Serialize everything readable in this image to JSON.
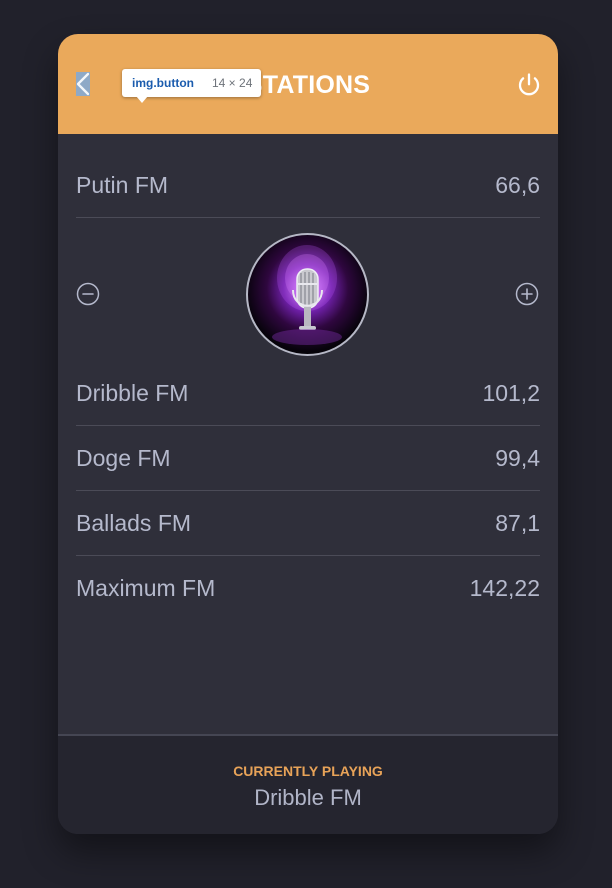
{
  "devtools_tooltip": {
    "element_name": "img.button",
    "element_type": "img",
    "element_class": ".button",
    "dimensions": "14 × 24"
  },
  "header": {
    "title": "STATIONS",
    "back_icon": "chevron-left-icon",
    "power_icon": "power-icon",
    "background_color": "#eaa95b"
  },
  "stations": [
    {
      "name": "Putin FM",
      "frequency": "66,6"
    },
    {
      "name": "Dribble FM",
      "frequency": "101,2"
    },
    {
      "name": "Doge FM",
      "frequency": "99,4"
    },
    {
      "name": "Ballads FM",
      "frequency": "87,1"
    },
    {
      "name": "Maximum FM",
      "frequency": "142,22"
    }
  ],
  "controls": {
    "minus_icon": "minus-circle-icon",
    "plus_icon": "plus-circle-icon",
    "artwork_icon": "microphone-icon"
  },
  "footer": {
    "label": "CURRENTLY PLAYING",
    "station": "Dribble FM",
    "label_color": "#e8a358"
  },
  "colors": {
    "background": "#21212b",
    "panel": "#2f2f3a",
    "text": "#b5b9cc",
    "divider": "#4b4b57"
  }
}
